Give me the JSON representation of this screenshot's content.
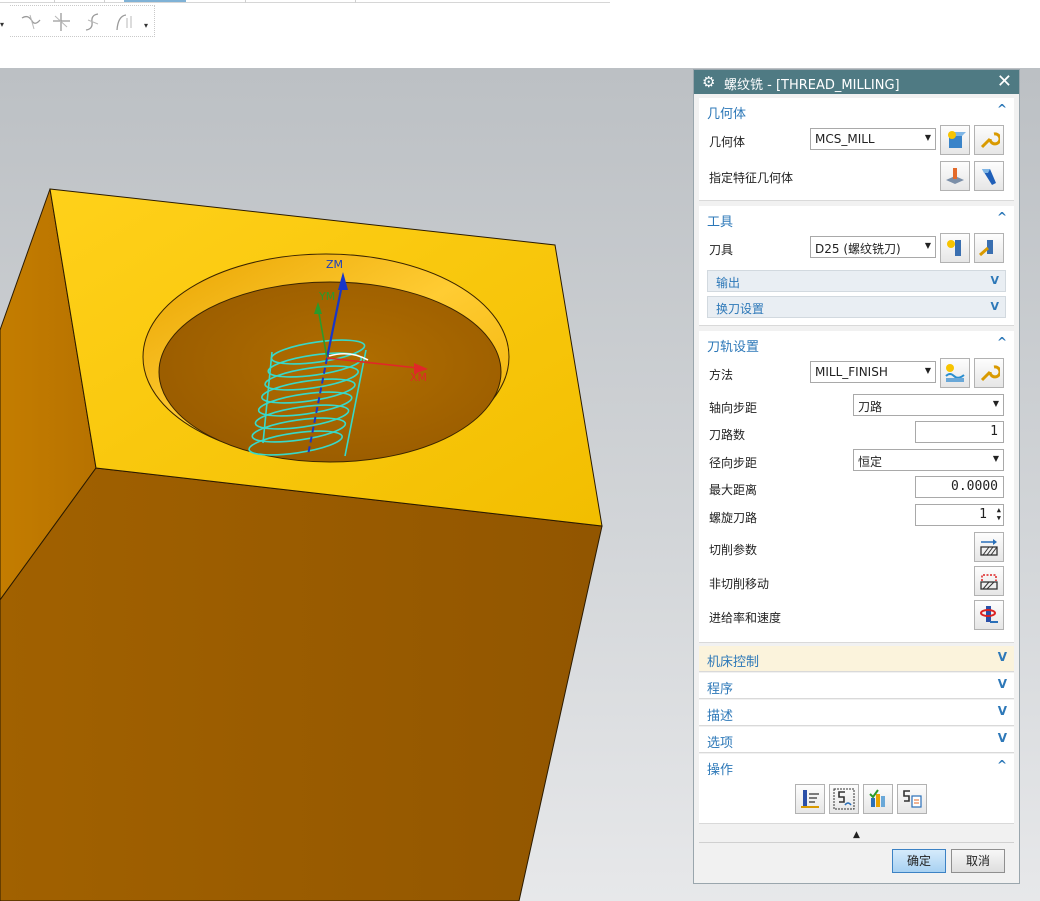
{
  "viewport": {
    "axis_labels": {
      "z": "ZM",
      "y": "YM",
      "x": "XM"
    }
  },
  "dialog": {
    "title": "螺纹铣 - [THREAD_MILLING]",
    "sections": {
      "geometry": {
        "title": "几何体",
        "geometry_label": "几何体",
        "geometry_value": "MCS_MILL",
        "feature_label": "指定特征几何体"
      },
      "tool": {
        "title": "工具",
        "tool_label": "刀具",
        "tool_value": "D25 (螺纹铣刀)",
        "output": "输出",
        "tool_change": "换刀设置"
      },
      "path": {
        "title": "刀轨设置",
        "method_label": "方法",
        "method_value": "MILL_FINISH",
        "axial_step_label": "轴向步距",
        "axial_step_value": "刀路",
        "num_paths_label": "刀路数",
        "num_paths_value": "1",
        "radial_step_label": "径向步距",
        "radial_step_value": "恒定",
        "max_dist_label": "最大距离",
        "max_dist_value": "0.0000",
        "helical_label": "螺旋刀路",
        "helical_value": "1",
        "cut_params_label": "切削参数",
        "non_cut_label": "非切削移动",
        "feeds_label": "进给率和速度"
      },
      "machine_control": "机床控制",
      "program": "程序",
      "description": "描述",
      "options": "选项",
      "actions": "操作"
    },
    "buttons": {
      "ok": "确定",
      "cancel": "取消"
    },
    "chevron_up": "^",
    "chevron_down": "V",
    "collapse_arrow": "▲"
  },
  "colors": {
    "title_bar": "#4f7a83",
    "section_title": "#2d78b8",
    "part_top": "#f7c400",
    "part_side": "#9d5f00",
    "toolpath": "#38d9c8"
  }
}
